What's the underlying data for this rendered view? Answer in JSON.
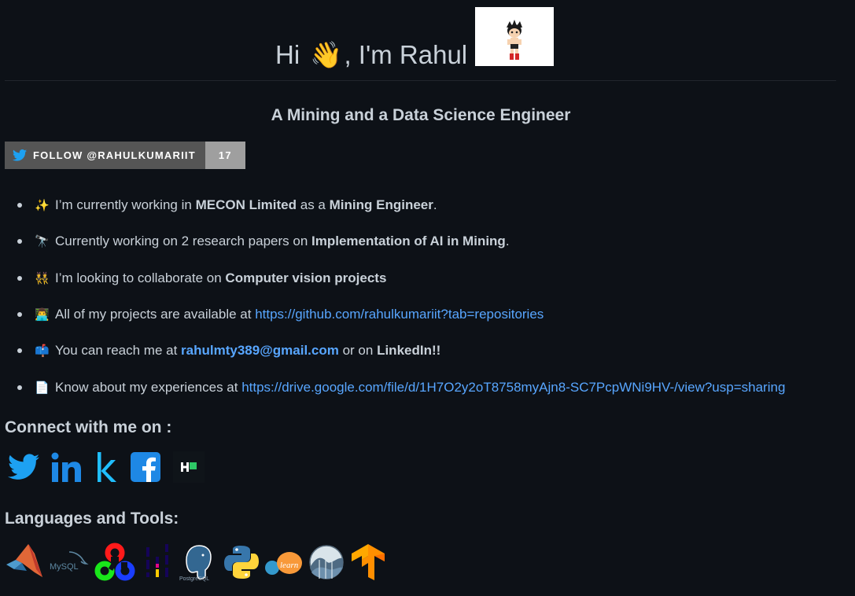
{
  "header": {
    "greeting_pre": "Hi ",
    "wave_emoji": "👋",
    "greeting_post": ", I'm Rahul",
    "avatar_icon": "astro-boy-avatar"
  },
  "subtitle": "A Mining and a Data Science Engineer",
  "follow_badge": {
    "label": "FOLLOW @RAHULKUMARIIT",
    "count": "17",
    "icon": "twitter-icon"
  },
  "bullets": [
    {
      "emoji": "✨",
      "parts": [
        "I’m currently working in ",
        "MECON Limited",
        " as a ",
        "Mining Engineer",
        "."
      ]
    },
    {
      "emoji": "🔭",
      "parts": [
        "Currently working on 2 research papers on ",
        "Implementation of AI in Mining",
        "."
      ]
    },
    {
      "emoji": "👯",
      "parts": [
        "I’m looking to collaborate on ",
        "Computer vision projects"
      ]
    },
    {
      "emoji": "👨‍💻",
      "parts": [
        "All of my projects are available at ",
        "https://github.com/rahulkumariit?tab=repositories"
      ]
    },
    {
      "emoji": "📫",
      "parts": [
        "You can reach me at ",
        "rahulmty389@gmail.com",
        " or on ",
        "LinkedIn!!"
      ]
    },
    {
      "emoji": "📄",
      "parts": [
        "Know about my experiences at ",
        "https://drive.google.com/file/d/1H7O2y2oT8758myAjn8-SC7PcpWNi9HV-/view?usp=sharing"
      ]
    }
  ],
  "connect": {
    "heading": "Connect with me on :",
    "icons": [
      "twitter-icon",
      "linkedin-icon",
      "kaggle-icon",
      "facebook-icon",
      "hackerrank-icon"
    ]
  },
  "tools": {
    "heading": "Languages and Tools:",
    "icons": [
      "matlab-icon",
      "mysql-icon",
      "opencv-icon",
      "pandas-icon",
      "postgresql-icon",
      "python-icon",
      "scikit-learn-icon",
      "seaborn-icon",
      "tensorflow-icon"
    ],
    "mysql_text": "MySQL",
    "postgres_text": "PostgreSQL",
    "sklearn_text": "learn"
  },
  "colors": {
    "background": "#0d1117",
    "text": "#c9d1d9",
    "link": "#58a6ff",
    "twitter": "#1da1f2",
    "linkedin": "#0a66c2",
    "kaggle": "#20beff",
    "facebook": "#1877f2",
    "hackerrank": "#2ec866"
  }
}
